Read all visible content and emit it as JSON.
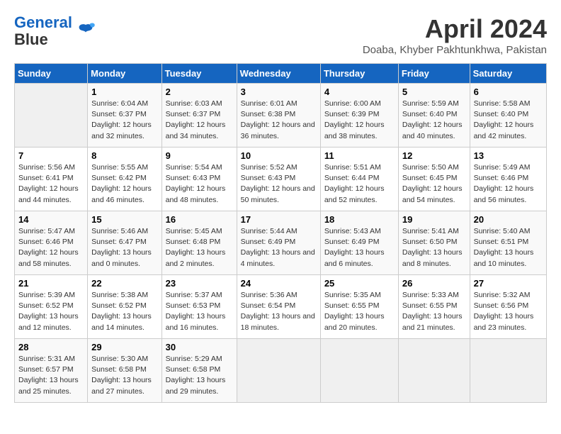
{
  "header": {
    "logo_line1": "General",
    "logo_line2": "Blue",
    "month": "April 2024",
    "location": "Doaba, Khyber Pakhtunkhwa, Pakistan"
  },
  "weekdays": [
    "Sunday",
    "Monday",
    "Tuesday",
    "Wednesday",
    "Thursday",
    "Friday",
    "Saturday"
  ],
  "weeks": [
    [
      {
        "day": "",
        "empty": true
      },
      {
        "day": "1",
        "sunrise": "6:04 AM",
        "sunset": "6:37 PM",
        "daylight": "12 hours and 32 minutes."
      },
      {
        "day": "2",
        "sunrise": "6:03 AM",
        "sunset": "6:37 PM",
        "daylight": "12 hours and 34 minutes."
      },
      {
        "day": "3",
        "sunrise": "6:01 AM",
        "sunset": "6:38 PM",
        "daylight": "12 hours and 36 minutes."
      },
      {
        "day": "4",
        "sunrise": "6:00 AM",
        "sunset": "6:39 PM",
        "daylight": "12 hours and 38 minutes."
      },
      {
        "day": "5",
        "sunrise": "5:59 AM",
        "sunset": "6:40 PM",
        "daylight": "12 hours and 40 minutes."
      },
      {
        "day": "6",
        "sunrise": "5:58 AM",
        "sunset": "6:40 PM",
        "daylight": "12 hours and 42 minutes."
      }
    ],
    [
      {
        "day": "7",
        "sunrise": "5:56 AM",
        "sunset": "6:41 PM",
        "daylight": "12 hours and 44 minutes."
      },
      {
        "day": "8",
        "sunrise": "5:55 AM",
        "sunset": "6:42 PM",
        "daylight": "12 hours and 46 minutes."
      },
      {
        "day": "9",
        "sunrise": "5:54 AM",
        "sunset": "6:43 PM",
        "daylight": "12 hours and 48 minutes."
      },
      {
        "day": "10",
        "sunrise": "5:52 AM",
        "sunset": "6:43 PM",
        "daylight": "12 hours and 50 minutes."
      },
      {
        "day": "11",
        "sunrise": "5:51 AM",
        "sunset": "6:44 PM",
        "daylight": "12 hours and 52 minutes."
      },
      {
        "day": "12",
        "sunrise": "5:50 AM",
        "sunset": "6:45 PM",
        "daylight": "12 hours and 54 minutes."
      },
      {
        "day": "13",
        "sunrise": "5:49 AM",
        "sunset": "6:46 PM",
        "daylight": "12 hours and 56 minutes."
      }
    ],
    [
      {
        "day": "14",
        "sunrise": "5:47 AM",
        "sunset": "6:46 PM",
        "daylight": "12 hours and 58 minutes."
      },
      {
        "day": "15",
        "sunrise": "5:46 AM",
        "sunset": "6:47 PM",
        "daylight": "13 hours and 0 minutes."
      },
      {
        "day": "16",
        "sunrise": "5:45 AM",
        "sunset": "6:48 PM",
        "daylight": "13 hours and 2 minutes."
      },
      {
        "day": "17",
        "sunrise": "5:44 AM",
        "sunset": "6:49 PM",
        "daylight": "13 hours and 4 minutes."
      },
      {
        "day": "18",
        "sunrise": "5:43 AM",
        "sunset": "6:49 PM",
        "daylight": "13 hours and 6 minutes."
      },
      {
        "day": "19",
        "sunrise": "5:41 AM",
        "sunset": "6:50 PM",
        "daylight": "13 hours and 8 minutes."
      },
      {
        "day": "20",
        "sunrise": "5:40 AM",
        "sunset": "6:51 PM",
        "daylight": "13 hours and 10 minutes."
      }
    ],
    [
      {
        "day": "21",
        "sunrise": "5:39 AM",
        "sunset": "6:52 PM",
        "daylight": "13 hours and 12 minutes."
      },
      {
        "day": "22",
        "sunrise": "5:38 AM",
        "sunset": "6:52 PM",
        "daylight": "13 hours and 14 minutes."
      },
      {
        "day": "23",
        "sunrise": "5:37 AM",
        "sunset": "6:53 PM",
        "daylight": "13 hours and 16 minutes."
      },
      {
        "day": "24",
        "sunrise": "5:36 AM",
        "sunset": "6:54 PM",
        "daylight": "13 hours and 18 minutes."
      },
      {
        "day": "25",
        "sunrise": "5:35 AM",
        "sunset": "6:55 PM",
        "daylight": "13 hours and 20 minutes."
      },
      {
        "day": "26",
        "sunrise": "5:33 AM",
        "sunset": "6:55 PM",
        "daylight": "13 hours and 21 minutes."
      },
      {
        "day": "27",
        "sunrise": "5:32 AM",
        "sunset": "6:56 PM",
        "daylight": "13 hours and 23 minutes."
      }
    ],
    [
      {
        "day": "28",
        "sunrise": "5:31 AM",
        "sunset": "6:57 PM",
        "daylight": "13 hours and 25 minutes."
      },
      {
        "day": "29",
        "sunrise": "5:30 AM",
        "sunset": "6:58 PM",
        "daylight": "13 hours and 27 minutes."
      },
      {
        "day": "30",
        "sunrise": "5:29 AM",
        "sunset": "6:58 PM",
        "daylight": "13 hours and 29 minutes."
      },
      {
        "day": "",
        "empty": true
      },
      {
        "day": "",
        "empty": true
      },
      {
        "day": "",
        "empty": true
      },
      {
        "day": "",
        "empty": true
      }
    ]
  ]
}
